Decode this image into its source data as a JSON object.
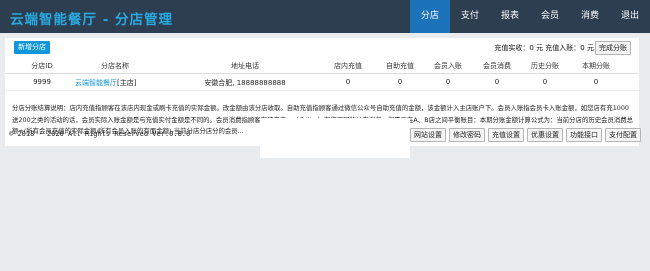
{
  "header": {
    "title": "云端智能餐厅 - 分店管理",
    "nav": [
      "分店",
      "支付",
      "报表",
      "会员",
      "消费",
      "退出"
    ],
    "active_nav": "分店"
  },
  "actions": {
    "add_branch": "新增分店",
    "summary_text": "充值实收：0 元 充值入账：0 元",
    "settle": "完成分账"
  },
  "table": {
    "columns": [
      "分店ID",
      "分店名称",
      "地址电话",
      "店内充值",
      "自助充值",
      "会员入账",
      "会员消费",
      "历史分账",
      "本期分账"
    ],
    "rows": [
      {
        "id": "9999",
        "name": "云端智能餐厅",
        "tag": "[主店]",
        "addr_phone": "安徽合肥, 18888888888",
        "instore_topup": "0",
        "self_topup": "0",
        "member_credit": "0",
        "member_spend": "0",
        "history_split": "0",
        "current_split": "0"
      }
    ]
  },
  "note": "分店分账结算说明：店内充值指顾客在该店内现金或刷卡充值的实际金额。改金额由该分店收取。自助充值指顾客通过微信公众号自助充值的金额，该金额计入主店账户下。会员入账指会员卡入账金额，如您店有充1000送200之类的活动的话，会员实际入账金额是与充值实付金额是不同的。会员消费指顾客在该店内...（含义...）在您不同的分店消费，您需要在A、B店之间平衡账目：本期分账金额计算公式为：当前分店的历史会员消费总额+(所有会员充值的实际金额/所有会员入账的有面金额)-当前分店分店分的会员...",
  "footer": {
    "copyright": "© 2018 - 2020 All Rights Reserved Ver:0.8.0",
    "buttons": [
      "网站设置",
      "修改密码",
      "充值设置",
      "优惠设置",
      "功能接口",
      "支付配置"
    ]
  }
}
